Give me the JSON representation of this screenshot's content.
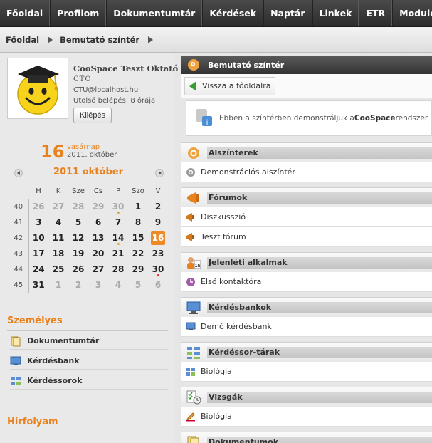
{
  "nav": [
    "Főoldal",
    "Profilom",
    "Dokumentumtár",
    "Kérdések",
    "Naptár",
    "Linkek",
    "ETR",
    "Modulo"
  ],
  "breadcrumb": [
    "Főoldal",
    "Bemutató színtér"
  ],
  "profile": {
    "name": "CooSpace Teszt Oktató",
    "code": "CTO",
    "email": "CTU@localhost.hu",
    "last_login": "Utolsó belépés: 8 órája",
    "logout_label": "Kilépés"
  },
  "today": {
    "day": "16",
    "weekday": "vasárnap",
    "month_year": "2011. október"
  },
  "calendar": {
    "title": "2011 október",
    "weekdays": [
      "H",
      "K",
      "Sze",
      "Cs",
      "P",
      "Szo",
      "V"
    ],
    "weeks": [
      {
        "wk": "40",
        "days": [
          "26",
          "27",
          "28",
          "29",
          "30",
          "1",
          "2"
        ]
      },
      {
        "wk": "41",
        "days": [
          "3",
          "4",
          "5",
          "6",
          "7",
          "8",
          "9"
        ]
      },
      {
        "wk": "42",
        "days": [
          "10",
          "11",
          "12",
          "13",
          "14",
          "15",
          "16"
        ]
      },
      {
        "wk": "43",
        "days": [
          "17",
          "18",
          "19",
          "20",
          "21",
          "22",
          "23"
        ]
      },
      {
        "wk": "44",
        "days": [
          "24",
          "25",
          "26",
          "27",
          "28",
          "29",
          "30"
        ]
      },
      {
        "wk": "45",
        "days": [
          "31",
          "1",
          "2",
          "3",
          "4",
          "5",
          "6"
        ]
      }
    ]
  },
  "personal": {
    "title": "Személyes",
    "items": [
      "Dokumentumtár",
      "Kérdésbank",
      "Kérdéssorok"
    ]
  },
  "feed": {
    "title": "Hírfolyam"
  },
  "main": {
    "header": "Bemutató színtér",
    "back_label": "Vissza a főoldalra",
    "info_prefix": "Ebben a színtérben demonstráljuk a ",
    "info_brand": "CooSpace",
    "info_suffix": " rendszer képe",
    "sections": [
      {
        "title": "Alszínterek",
        "items": [
          "Demonstrációs alszíntér"
        ]
      },
      {
        "title": "Fórumok",
        "items": [
          "Diszkusszió",
          "Teszt fórum"
        ]
      },
      {
        "title": "Jelenléti alkalmak",
        "items": [
          "Első kontaktóra"
        ]
      },
      {
        "title": "Kérdésbankok",
        "items": [
          "Demó kérdésbank"
        ]
      },
      {
        "title": "Kérdéssor-tárak",
        "items": [
          "Biológia"
        ]
      },
      {
        "title": "Vizsgák",
        "items": [
          "Biológia"
        ]
      },
      {
        "title": "Dokumentumok",
        "items": []
      }
    ]
  },
  "colors": {
    "accent": "#e8821e",
    "nav_bg": "#333333",
    "green_arrow": "#3a9e2e"
  }
}
